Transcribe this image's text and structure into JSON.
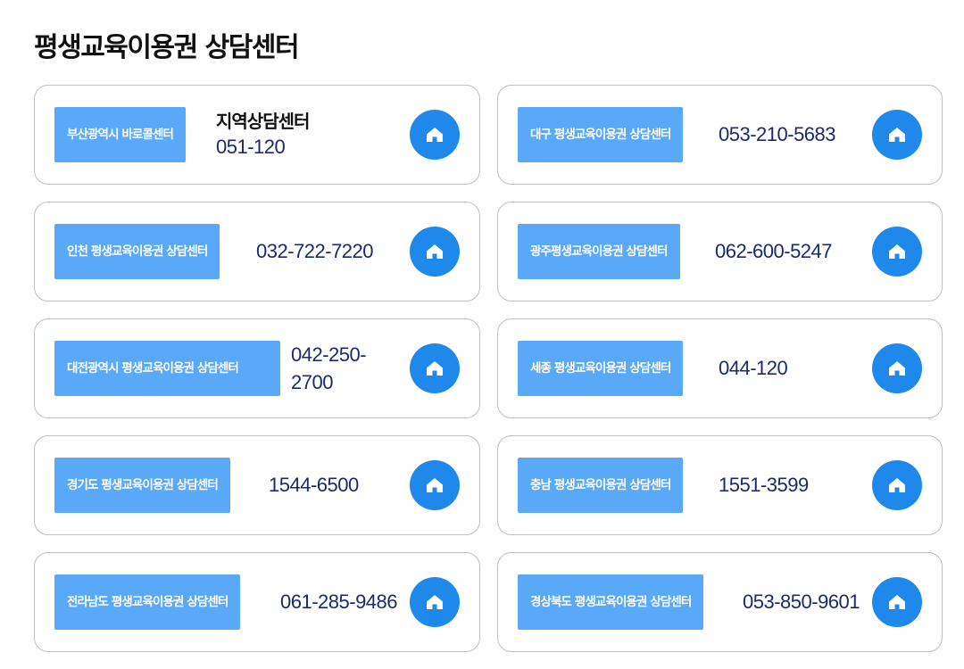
{
  "page": {
    "title": "평생교육이용권 상담센터"
  },
  "centers": [
    {
      "label": "부산광역시 바로콜센터",
      "title": "지역상담센터",
      "phone": "051-120"
    },
    {
      "label": "대구 평생교육이용권 상담센터",
      "phone": "053-210-5683"
    },
    {
      "label": "인천 평생교육이용권 상담센터",
      "phone": "032-722-7220"
    },
    {
      "label": "광주평생교육이용권 상담센터",
      "phone": "062-600-5247"
    },
    {
      "label": "대전광역시 평생교육이용권 상담센터",
      "phone": "042-250-2700"
    },
    {
      "label": "세종 평생교육이용권 상담센터",
      "phone": "044-120"
    },
    {
      "label": "경기도 평생교육이용권 상담센터",
      "phone": "1544-6500"
    },
    {
      "label": "충남 평생교육이용권 상담센터",
      "phone": "1551-3599"
    },
    {
      "label": "전라남도 평생교육이용권 상담센터",
      "phone": "061-285-9486"
    },
    {
      "label": "경상북도 평생교육이용권 상담센터",
      "phone": "053-850-9601"
    }
  ],
  "icons": {
    "home": "home-icon"
  },
  "colors": {
    "label_bg": "#5aa9f8",
    "home_button": "#1e88eb",
    "phone_text": "#1c2a6b",
    "card_border": "#bfbfbf"
  }
}
